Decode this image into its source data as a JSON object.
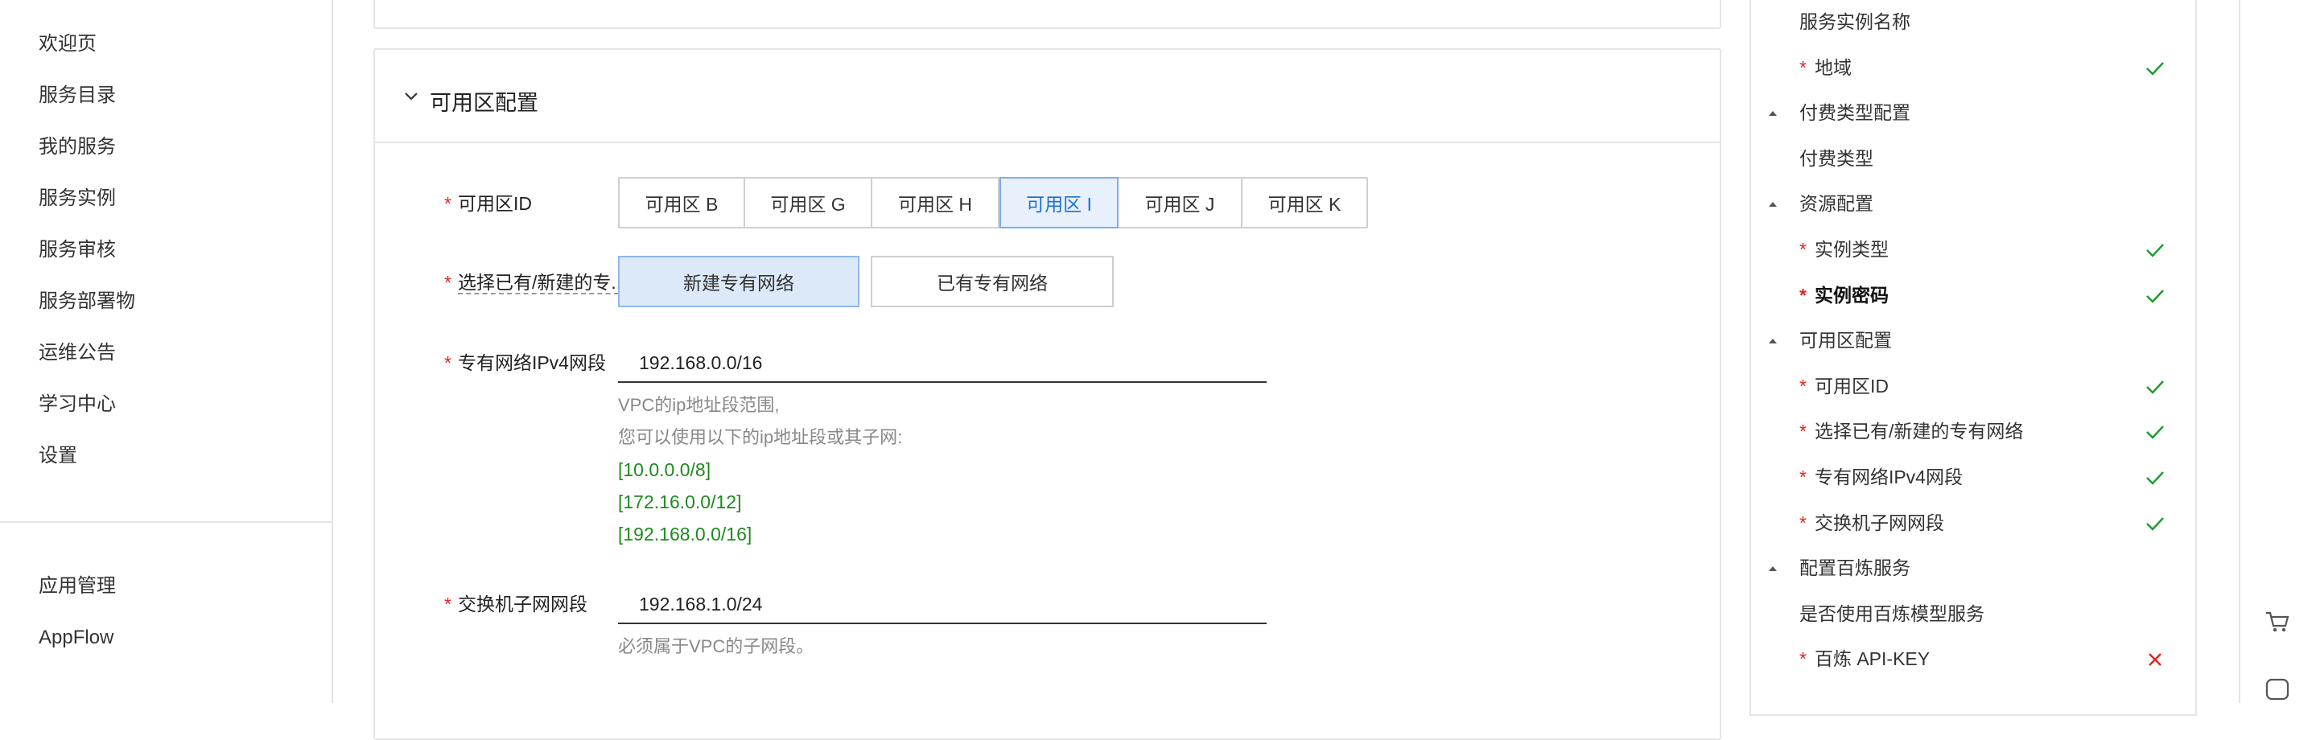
{
  "nav": {
    "items": [
      "欢迎页",
      "服务目录",
      "我的服务",
      "服务实例",
      "服务审核",
      "服务部署物",
      "运维公告",
      "学习中心",
      "设置"
    ],
    "bottom_items": [
      "应用管理",
      "AppFlow"
    ]
  },
  "section": {
    "title": "可用区配置",
    "zone_label": "可用区ID",
    "zones": [
      "可用区 B",
      "可用区 G",
      "可用区 H",
      "可用区 I",
      "可用区 J",
      "可用区 K"
    ],
    "selected_zone": "可用区 I",
    "vpc_choice_label": "选择已有/新建的专...",
    "vpc_options": [
      "新建专有网络",
      "已有专有网络"
    ],
    "selected_vpc_option": "新建专有网络",
    "vpc_cidr_label": "专有网络IPv4网段",
    "vpc_cidr_value": "192.168.0.0/16",
    "vpc_help_1": "VPC的ip地址段范围,",
    "vpc_help_2": "您可以使用以下的ip地址段或其子网:",
    "vpc_ranges": [
      "[10.0.0.0/8]",
      "[172.16.0.0/12]",
      "[192.168.0.0/16]"
    ],
    "vsw_cidr_label": "交换机子网网段",
    "vsw_cidr_value": "192.168.1.0/24",
    "vsw_help": "必须属于VPC的子网段。"
  },
  "outline": {
    "items": [
      {
        "label": "服务实例名称",
        "required": false,
        "group": false,
        "status": "none"
      },
      {
        "label": "地域",
        "required": true,
        "group": false,
        "status": "ok"
      },
      {
        "label": "付费类型配置",
        "required": false,
        "group": true,
        "status": "none"
      },
      {
        "label": "付费类型",
        "required": false,
        "group": false,
        "status": "none"
      },
      {
        "label": "资源配置",
        "required": false,
        "group": true,
        "status": "none"
      },
      {
        "label": "实例类型",
        "required": true,
        "group": false,
        "status": "ok"
      },
      {
        "label": "实例密码",
        "required": true,
        "group": false,
        "status": "ok",
        "bold": true
      },
      {
        "label": "可用区配置",
        "required": false,
        "group": true,
        "status": "none"
      },
      {
        "label": "可用区ID",
        "required": true,
        "group": false,
        "status": "ok"
      },
      {
        "label": "选择已有/新建的专有网络",
        "required": true,
        "group": false,
        "status": "ok"
      },
      {
        "label": "专有网络IPv4网段",
        "required": true,
        "group": false,
        "status": "ok"
      },
      {
        "label": "交换机子网网段",
        "required": true,
        "group": false,
        "status": "ok"
      },
      {
        "label": "配置百炼服务",
        "required": false,
        "group": true,
        "status": "none"
      },
      {
        "label": "是否使用百炼模型服务",
        "required": false,
        "group": false,
        "status": "none"
      },
      {
        "label": "百炼 API-KEY",
        "required": true,
        "group": false,
        "status": "error"
      }
    ]
  },
  "colors": {
    "required": "#e0261e",
    "ok": "#1e9a2e",
    "error": "#e0261e",
    "accent": "#1f6fd1",
    "range_text": "#1e8a1e"
  },
  "icons": {
    "collapse": "chevron-left-icon",
    "section_toggle": "chevron-down-icon",
    "cart": "cart-icon",
    "ai": "ai-icon"
  }
}
